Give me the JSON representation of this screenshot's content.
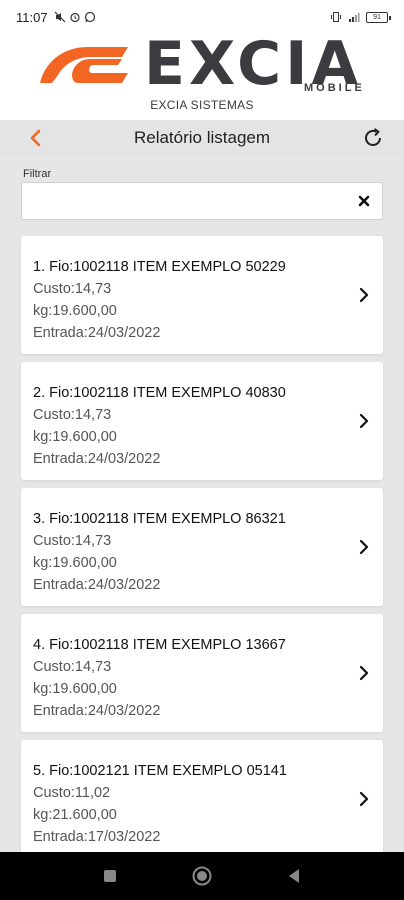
{
  "status_bar": {
    "time": "11:07",
    "left_icons": [
      "mute-icon",
      "alarm-icon",
      "whatsapp-icon"
    ],
    "right_icons": [
      "vibrate-icon",
      "signal-icon"
    ],
    "battery": "91"
  },
  "brand": {
    "logo_word": "EXCIA",
    "logo_mobile": "MOBILE",
    "subtitle": "EXCIA SISTEMAS",
    "accent_color": "#f26522",
    "dark_color": "#3b3b40"
  },
  "app_bar": {
    "title": "Relatório listagem",
    "back_icon": "chevron-left-icon",
    "refresh_icon": "refresh-icon"
  },
  "filter": {
    "label": "Filtrar",
    "value": "",
    "clear_icon": "close-icon"
  },
  "items": [
    {
      "title": "1. Fio:1002118 ITEM EXEMPLO 50229",
      "custo": "Custo:14,73",
      "kg": "kg:19.600,00",
      "entrada": "Entrada:24/03/2022"
    },
    {
      "title": "2. Fio:1002118 ITEM EXEMPLO 40830",
      "custo": "Custo:14,73",
      "kg": "kg:19.600,00",
      "entrada": "Entrada:24/03/2022"
    },
    {
      "title": "3. Fio:1002118 ITEM EXEMPLO 86321",
      "custo": "Custo:14,73",
      "kg": "kg:19.600,00",
      "entrada": "Entrada:24/03/2022"
    },
    {
      "title": "4. Fio:1002118 ITEM EXEMPLO 13667",
      "custo": "Custo:14,73",
      "kg": "kg:19.600,00",
      "entrada": "Entrada:24/03/2022"
    },
    {
      "title": "5. Fio:1002121 ITEM EXEMPLO 05141",
      "custo": "Custo:11,02",
      "kg": "kg:21.600,00",
      "entrada": "Entrada:17/03/2022"
    }
  ],
  "nav_bar": {
    "buttons": [
      "recents-icon",
      "home-icon",
      "back-triangle-icon"
    ]
  }
}
